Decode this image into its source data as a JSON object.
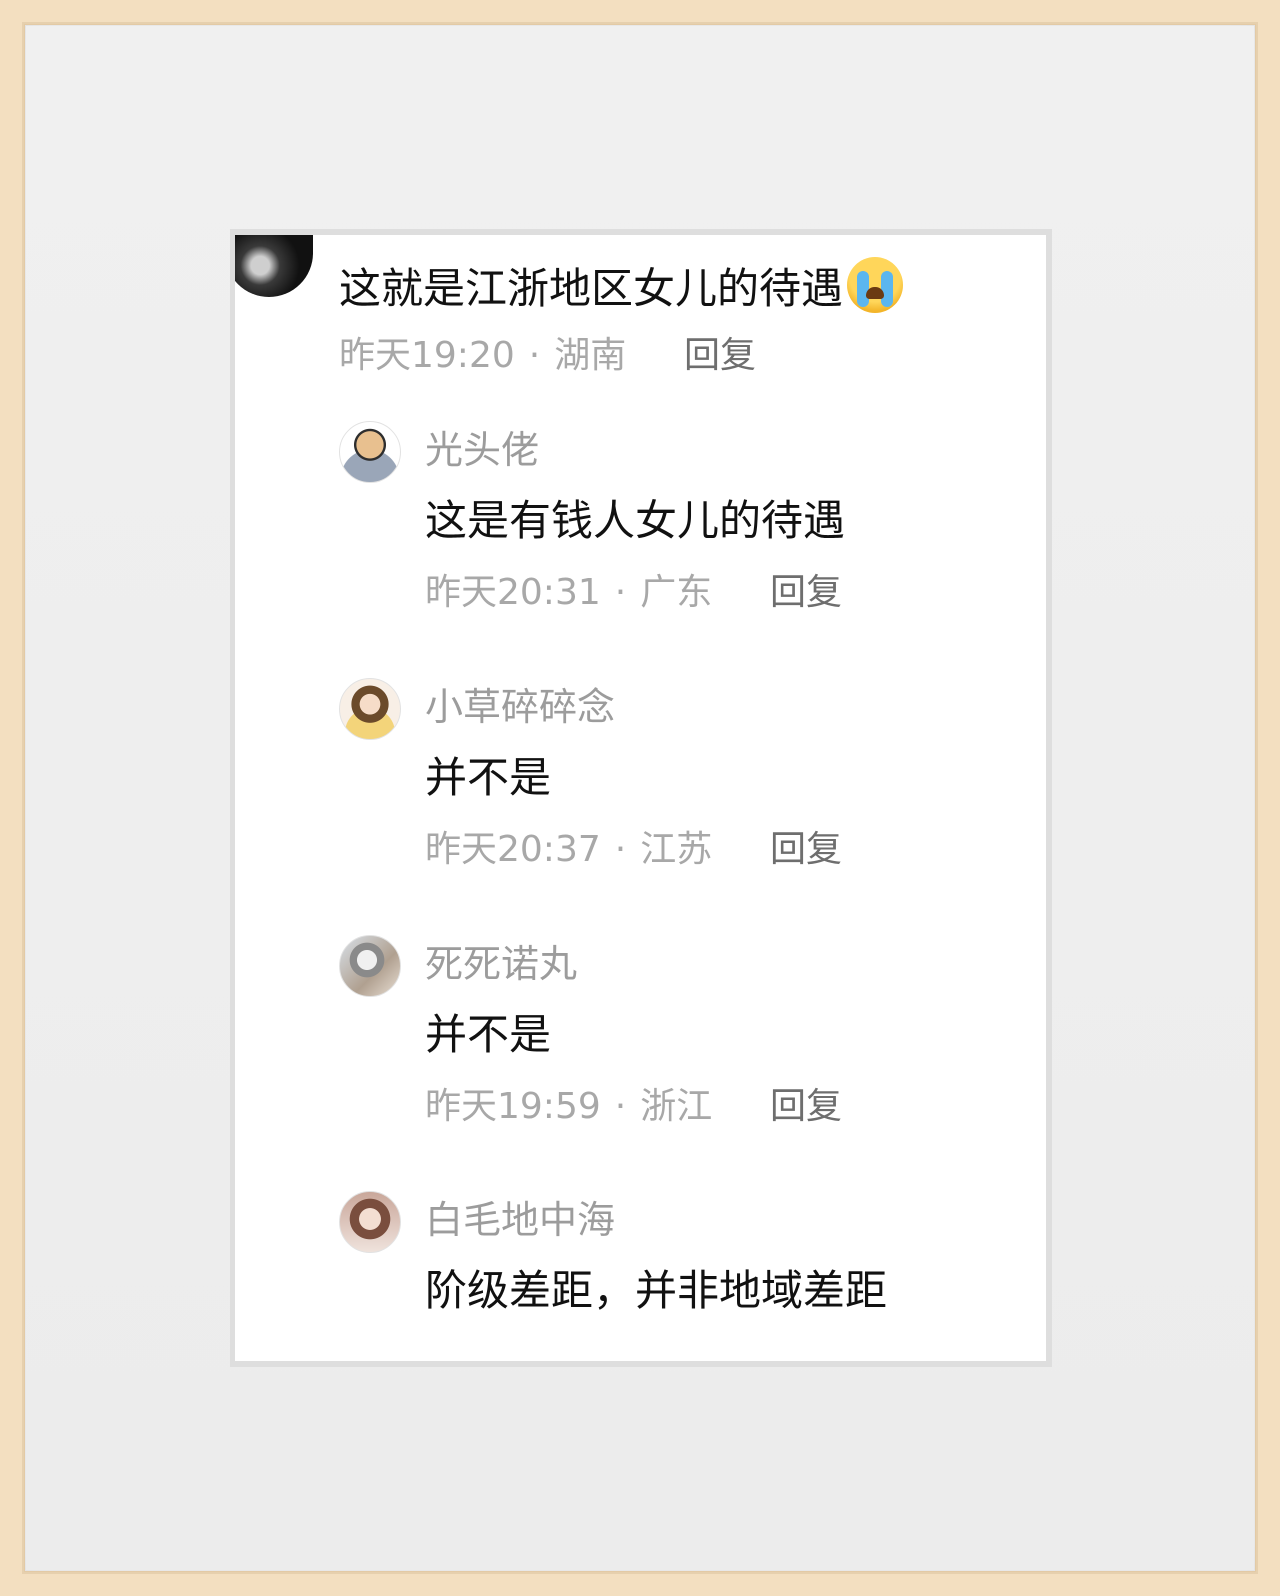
{
  "main_comment": {
    "text": "这就是江浙地区女儿的待遇",
    "emoji": "crying-face-emoji",
    "time": "昨天19:20",
    "location": "湖南",
    "reply_label": "回复"
  },
  "replies": [
    {
      "username": "光头佬",
      "text": "这是有钱人女儿的待遇",
      "time": "昨天20:31",
      "location": "广东",
      "reply_label": "回复"
    },
    {
      "username": "小草碎碎念",
      "text": "并不是",
      "time": "昨天20:37",
      "location": "江苏",
      "reply_label": "回复"
    },
    {
      "username": "死死诺丸",
      "text": "并不是",
      "time": "昨天19:59",
      "location": "浙江",
      "reply_label": "回复"
    },
    {
      "username": "白毛地中海",
      "text": "阶级差距，并非地域差距"
    }
  ],
  "separator": "·"
}
